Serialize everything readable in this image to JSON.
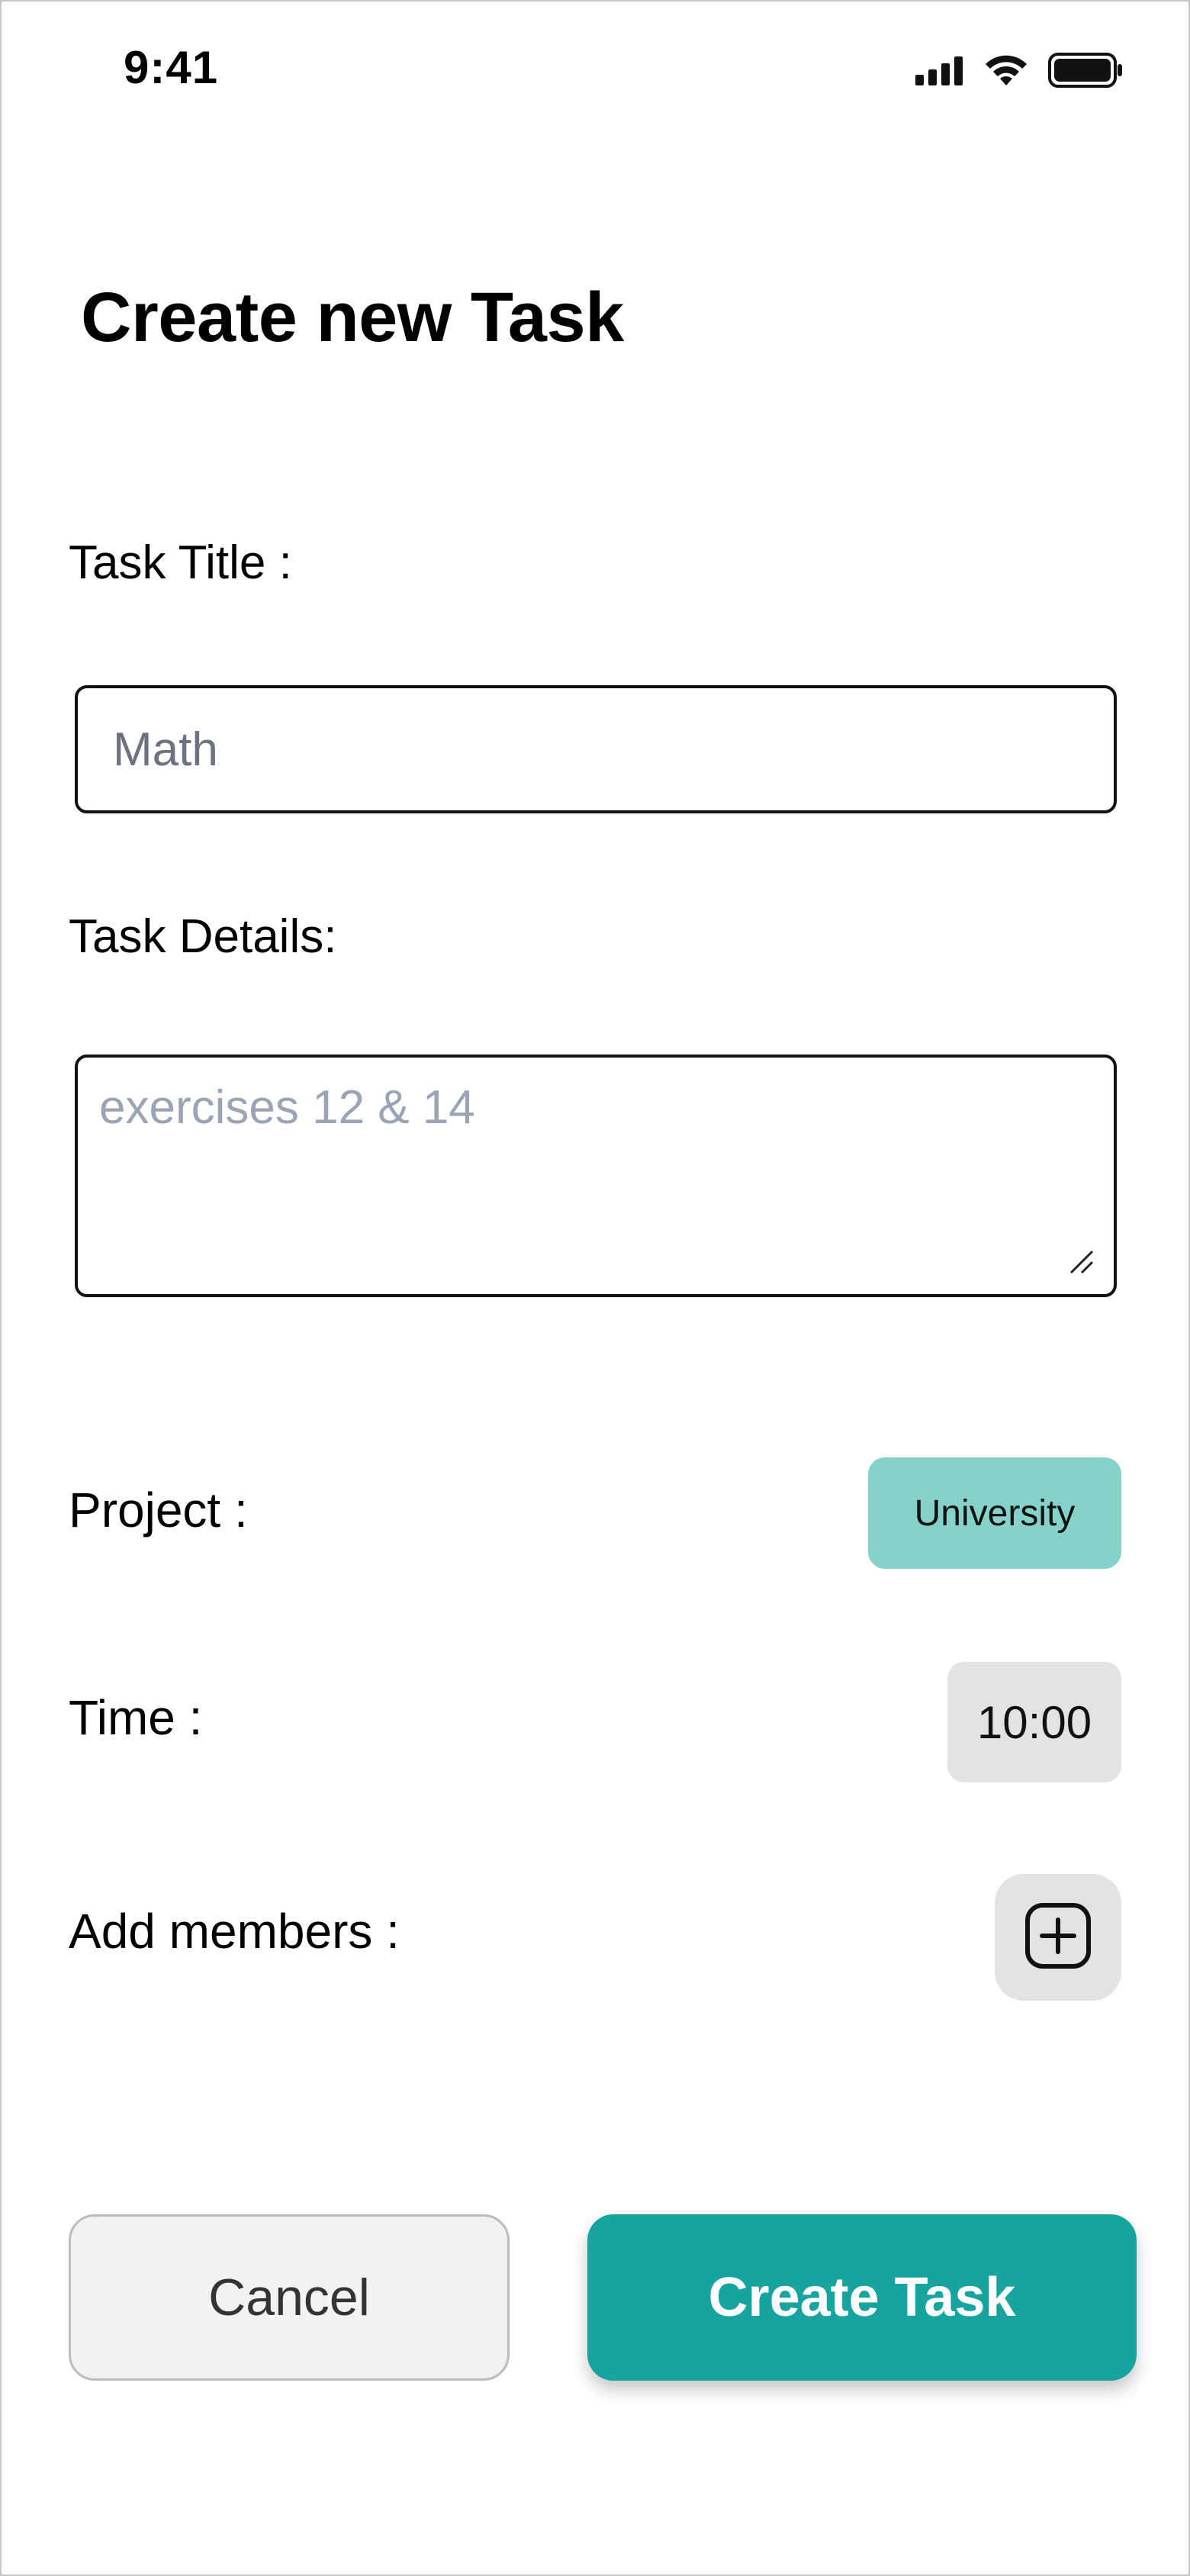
{
  "status_bar": {
    "time": "9:41"
  },
  "page": {
    "title": "Create new Task"
  },
  "form": {
    "task_title_label": "Task Title :",
    "task_title_placeholder": "Math",
    "task_details_label": "Task Details:",
    "task_details_placeholder": "exercises 12 & 14",
    "project_label": "Project :",
    "project_value": "University",
    "time_label": "Time :",
    "time_value": "10:00",
    "members_label": "Add members :"
  },
  "actions": {
    "cancel_label": "Cancel",
    "create_label": "Create Task"
  },
  "icons": {
    "signal": "cellular-signal-icon",
    "wifi": "wifi-icon",
    "battery": "battery-icon",
    "add_member": "plus-square-icon",
    "resize": "resize-handle-icon"
  },
  "colors": {
    "accent": "#17a3a0",
    "project_chip": "#85d2ca",
    "chip_gray": "#e3e3e3",
    "cancel_bg": "#f1f2f4"
  }
}
